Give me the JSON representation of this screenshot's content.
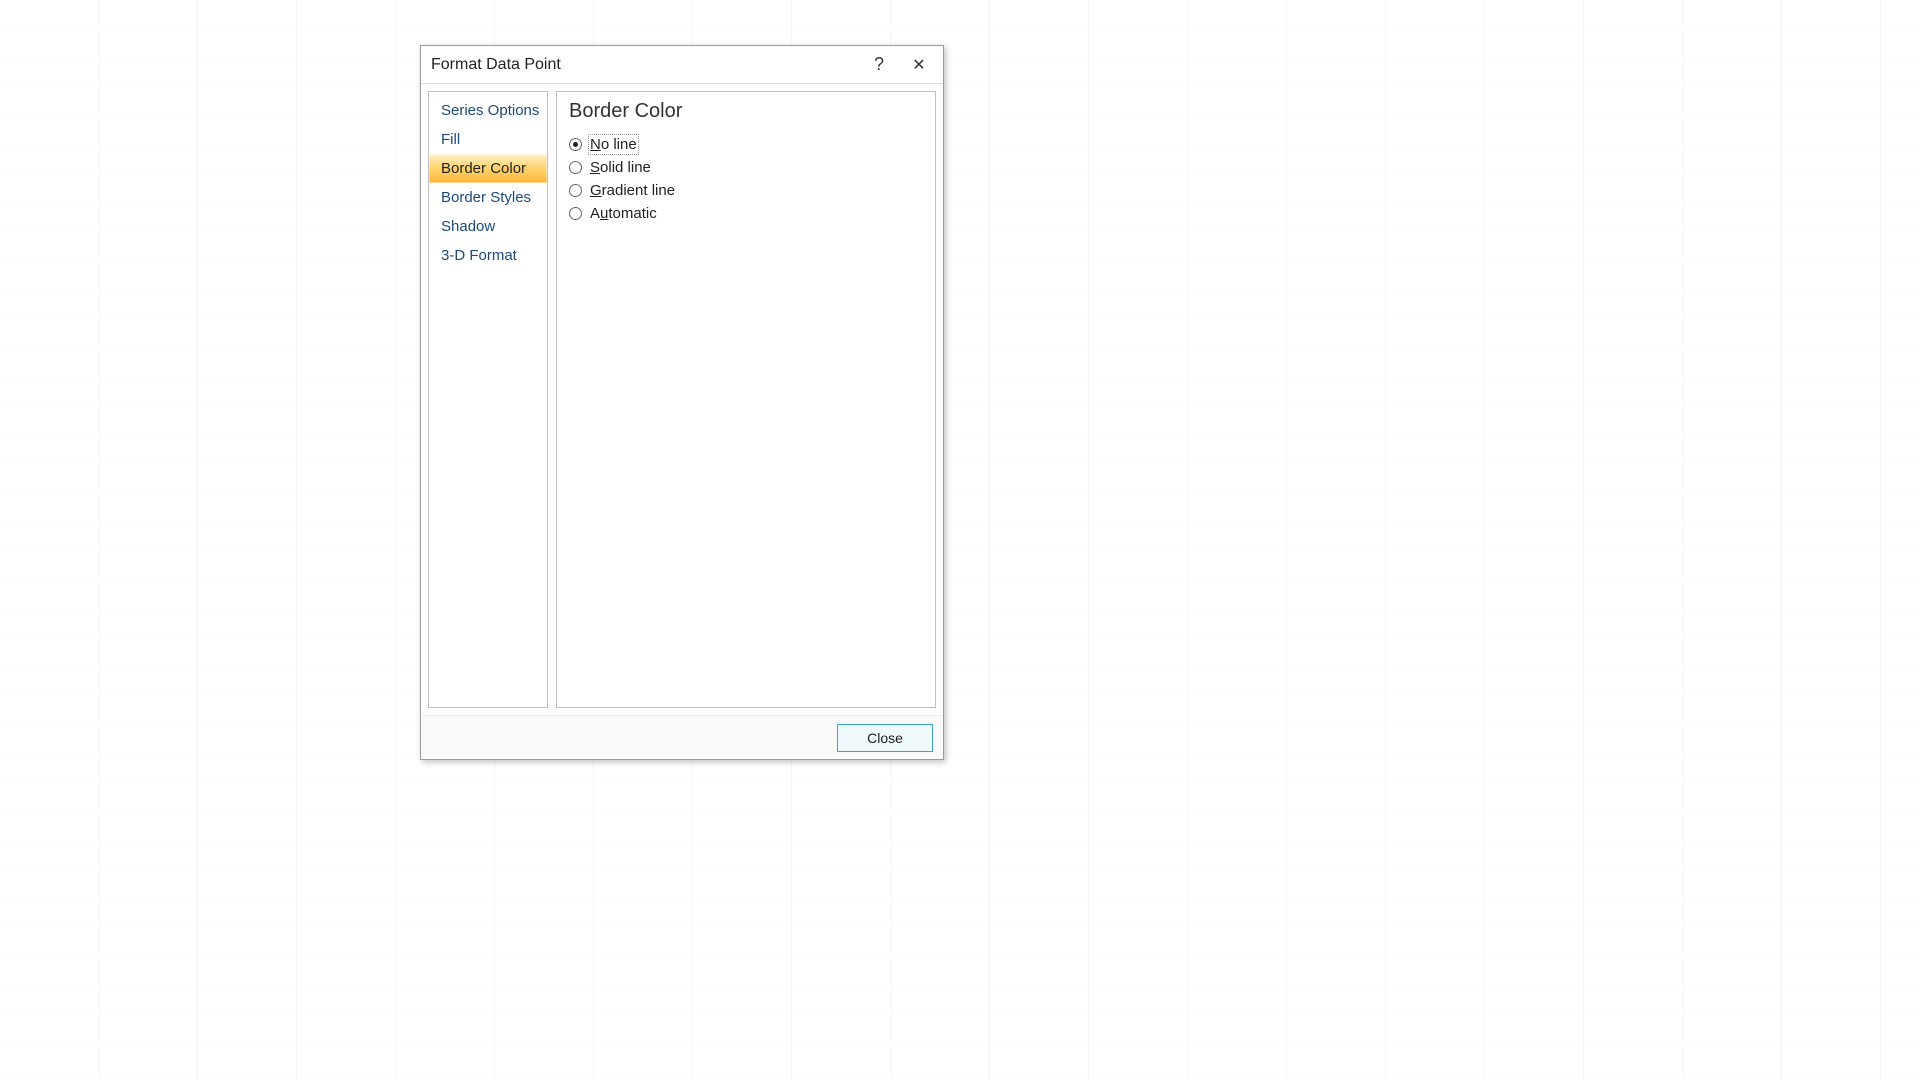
{
  "dialog": {
    "title": "Format Data Point",
    "help_label": "?",
    "close_glyph": "✕",
    "footer": {
      "close": "Close"
    }
  },
  "sidebar": {
    "items": [
      {
        "label": "Series Options",
        "selected": false
      },
      {
        "label": "Fill",
        "selected": false
      },
      {
        "label": "Border Color",
        "selected": true
      },
      {
        "label": "Border Styles",
        "selected": false
      },
      {
        "label": "Shadow",
        "selected": false
      },
      {
        "label": "3-D Format",
        "selected": false
      }
    ]
  },
  "panel": {
    "heading": "Border Color",
    "options": [
      {
        "value": "no_line",
        "checked": true,
        "mnemonic_index": 0,
        "label": "No line"
      },
      {
        "value": "solid_line",
        "checked": false,
        "mnemonic_index": 0,
        "label": "Solid line"
      },
      {
        "value": "gradient_line",
        "checked": false,
        "mnemonic_index": 0,
        "label": "Gradient line"
      },
      {
        "value": "automatic",
        "checked": false,
        "mnemonic_index": 1,
        "label": "Automatic"
      }
    ]
  }
}
